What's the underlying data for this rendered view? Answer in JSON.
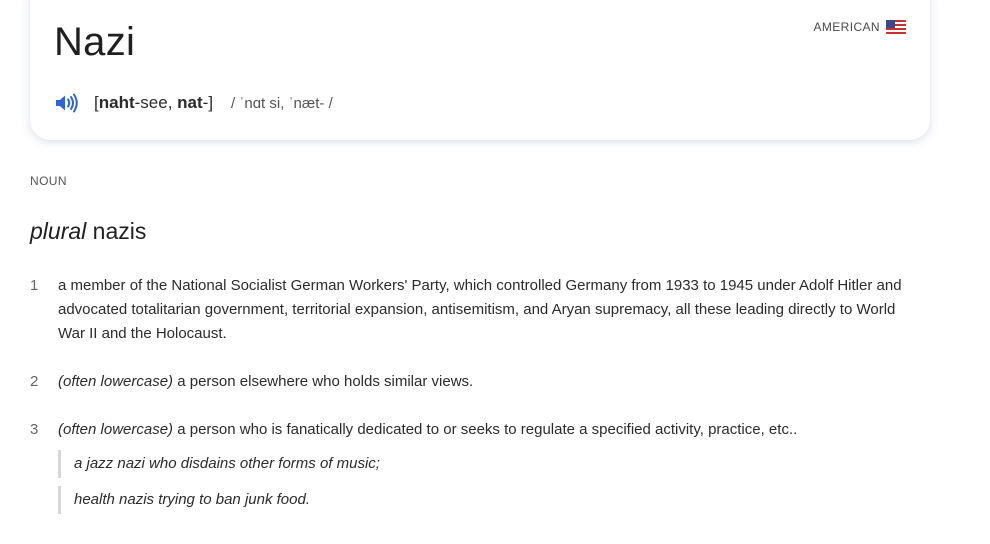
{
  "entry": {
    "headword": "Nazi",
    "region_label": "AMERICAN",
    "region_flag": "us-flag-icon",
    "pronunciation": {
      "spell_1": "[",
      "spell_bold_1": "naht",
      "spell_2": "-see, ",
      "spell_bold_2": "nat",
      "spell_3": "-]",
      "ipa": "/ ˈnɑt si, ˈnæt- /"
    }
  },
  "grammar": {
    "part_of_speech": "NOUN",
    "plural_label": "plural",
    "plural_form": "nazis"
  },
  "senses": [
    {
      "number": "1",
      "label": "",
      "text": "a member of the National Socialist German Workers' Party, which controlled Germany from 1933 to 1945 under Adolf Hitler and advocated totalitarian government, territorial expansion, antisemitism, and Aryan supremacy, all these leading directly to World War II and the Holocaust."
    },
    {
      "number": "2",
      "label": "(often lowercase)",
      "text": " a person elsewhere who holds similar views."
    },
    {
      "number": "3",
      "label": "(often lowercase)",
      "text": " a person who is fanatically dedicated to or seeks to regulate a specified activity, practice, etc.."
    }
  ],
  "examples": [
    "a jazz nazi who disdains other forms of music;",
    "health nazis trying to ban junk food."
  ],
  "colors": {
    "speaker_icon": "#2f63d8",
    "example_bar": "#d6d6d6"
  }
}
